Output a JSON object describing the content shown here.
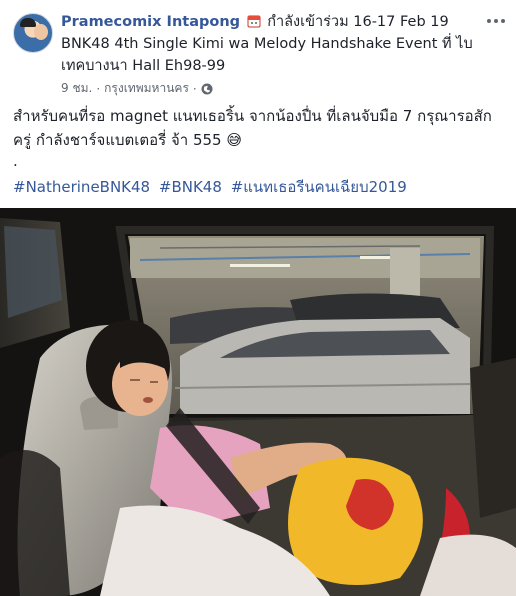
{
  "post": {
    "author": "Pramecomix Intapong",
    "status_prefix": "กำลังเข้าร่วม",
    "event_line1": "16-17 Feb 19",
    "event_line2": "BNK48 4th Single Kimi wa Melody Handshake Event ที่ ไบ",
    "event_line3": "เทคบางนา Hall Eh98-99",
    "time": "9 ชม.",
    "separator": "·",
    "location": "กรุงเทพมหานคร",
    "privacy_separator": "·",
    "text_line1": "สำหรับคนที่รอ magnet แนทเธอริ้น จากน้องปื่น ที่เลนจับมือ 7 กรุณารอสัก",
    "text_line2": "ครู่ กำลังชาร์จแบตเตอรี่ จ้า 555",
    "emoji": "😅",
    "dot": ".",
    "hashtags": [
      "#NatherineBNK48",
      "#BNK48",
      "#แนทเธอรีนคนเฉียบ2019"
    ]
  },
  "icons": {
    "calendar": "calendar-icon",
    "globe": "globe-icon",
    "more": "more-options-icon"
  },
  "colors": {
    "link": "#365899",
    "text": "#1d2129",
    "meta": "#606770"
  }
}
